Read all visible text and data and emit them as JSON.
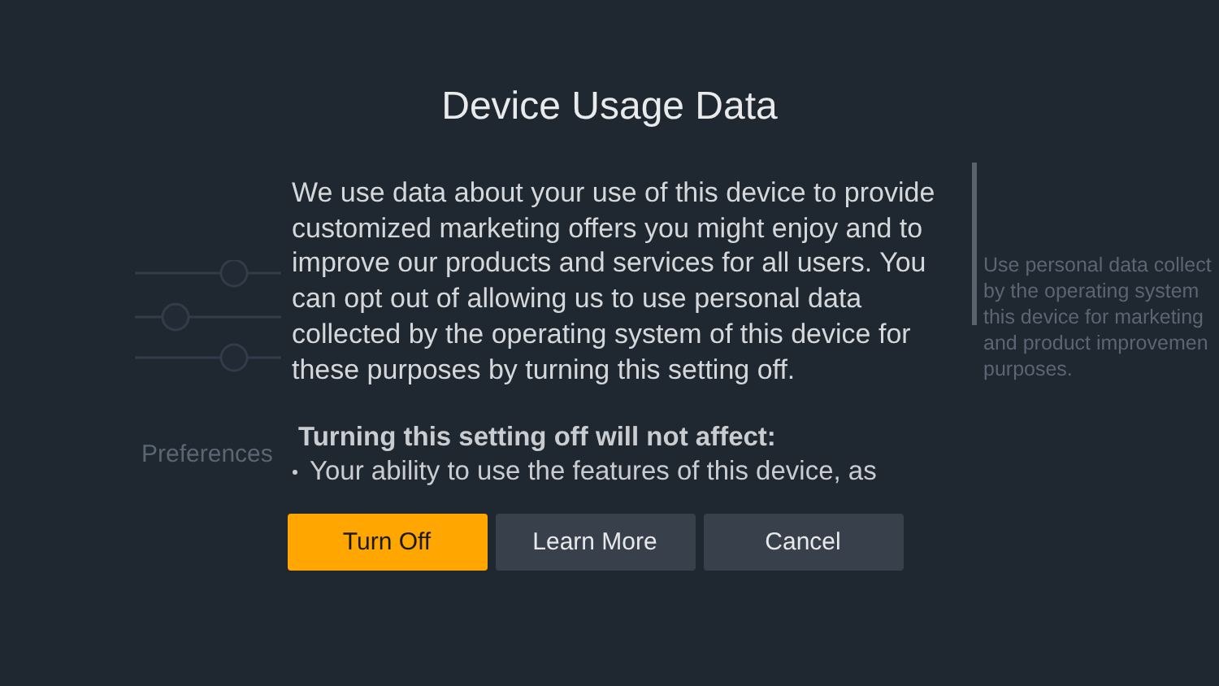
{
  "background": {
    "section_label": "Preferences",
    "description_lines": [
      "Use personal data collect",
      "by the operating system",
      "this device for marketing",
      "and product improvemen",
      "purposes."
    ]
  },
  "dialog": {
    "title": "Device Usage Data",
    "body": "We use data about your use of this device to provide customized marketing offers you might enjoy and to improve our products and services for all users. You can opt out of allowing us to use personal data collected by the operating system of this device for these purposes by turning this setting off.",
    "subheading": "Turning this setting off will not affect:",
    "bullets": [
      "Your ability to use the features of this device, as"
    ],
    "buttons": [
      {
        "label": "Turn Off",
        "selected": true
      },
      {
        "label": "Learn More",
        "selected": false
      },
      {
        "label": "Cancel",
        "selected": false
      }
    ]
  }
}
